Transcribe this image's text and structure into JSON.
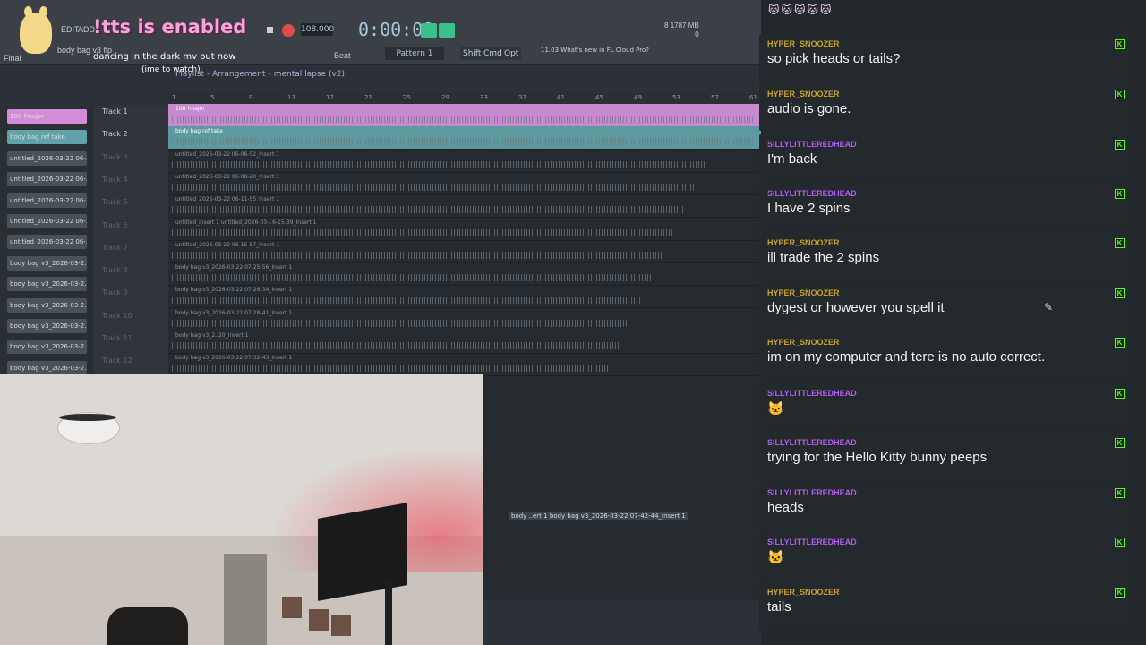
{
  "overlay": {
    "title": "!tts is enabled",
    "now_playing": "dancing in the dark mv out now",
    "now_playing_sub": "(ime to watch)"
  },
  "toolbar": {
    "edit_label": "EDIT",
    "add_label": "ADD",
    "project_name": "body bag v3 flp",
    "finalize_label": "Final",
    "bpm": "108.000",
    "time": "0:00:00",
    "cpu": "8",
    "memory": "1787 MB",
    "voices": "0",
    "beat_label": "Beat",
    "pattern_label": "Pattern 1",
    "shift_label": "Shift",
    "cmd_label": "Cmd",
    "opt_label": "Opt",
    "news_date": "11.03",
    "news_text": "What's new in FL Cloud Pro?"
  },
  "breadcrumb": {
    "section": "Playlist - Arrangement",
    "arrangement": "mental lapse (v2)"
  },
  "ruler": [
    "1",
    "5",
    "9",
    "13",
    "17",
    "21",
    "25",
    "29",
    "33",
    "37",
    "41",
    "45",
    "49",
    "53",
    "57",
    "61"
  ],
  "clips": [
    {
      "label": "108 fmajor",
      "color": "#d48bd8"
    },
    {
      "label": "body bag ref take",
      "color": "#5fa3a8"
    },
    {
      "label": "untitled_2026-03-22 06-...",
      "color": "#4a5258"
    },
    {
      "label": "untitled_2026-03-22 06-...",
      "color": "#4a5258"
    },
    {
      "label": "untitled_2026-03-22 06-...",
      "color": "#4a5258"
    },
    {
      "label": "untitled_2026-03-22 06-...",
      "color": "#4a5258"
    },
    {
      "label": "untitled_2026-03-22 06-...",
      "color": "#4a5258"
    },
    {
      "label": "body bag v3_2026-03-2...",
      "color": "#4a5258"
    },
    {
      "label": "body bag v3_2026-03-2...",
      "color": "#4a5258"
    },
    {
      "label": "body bag v3_2026-03-2...",
      "color": "#4a5258"
    },
    {
      "label": "body bag v3_2026-03-2...",
      "color": "#4a5258"
    },
    {
      "label": "body bag v3_2026-03-2...",
      "color": "#4a5258"
    },
    {
      "label": "body bag v3_2026-03-2...",
      "color": "#4a5258"
    }
  ],
  "tracks": [
    "Track 1",
    "Track 2",
    "Track 3",
    "Track 4",
    "Track 5",
    "Track 6",
    "Track 7",
    "Track 8",
    "Track 9",
    "Track 10",
    "Track 11",
    "Track 12"
  ],
  "lanes": [
    {
      "label": "108 fmajor"
    },
    {
      "label": "body bag ref take"
    },
    {
      "label": "untitled_2026-03-22 06-06-52_Insert 1"
    },
    {
      "label": "untitled_2026-03-22 06-08-20_Insert 1"
    },
    {
      "label": "untitled_2026-03-22 06-11-55_Insert 1"
    },
    {
      "label": "untitled_insert 1   untitled_2026-03-..6-15-39_Insert 1"
    },
    {
      "label": "untitled_2026-03-22 06-15-57_Insert 1"
    },
    {
      "label": "body bag v3_2026-03-22 07-25-56_Insert 1"
    },
    {
      "label": "body bag v3_2026-03-22 07-26-34_Insert 1"
    },
    {
      "label": "body bag v3_2026-03-22 07-28-41_Insert 1"
    },
    {
      "label": "body bag v3_2..20_Insert 1"
    },
    {
      "label": "body bag v3_2026-03-22 07-32-43_Insert 1"
    }
  ],
  "bottom_clip_label": "body ..ert 1   body bag v3_2026-03-22 07-42-44_Insert 1",
  "chat": {
    "top_emotes": "🐱🐱🐱🐱🐱",
    "messages": [
      {
        "user": "HYPER_SNOOZER",
        "text": "so pick heads or tails?",
        "color": "#c9a227"
      },
      {
        "user": "HYPER_SNOOZER",
        "text": "audio is gone.",
        "color": "#c9a227"
      },
      {
        "user": "SILLYLITTLEREDHEAD",
        "text": "I'm back",
        "color": "#b25cf0"
      },
      {
        "user": "SILLYLITTLEREDHEAD",
        "text": "I have 2 spins",
        "color": "#b25cf0"
      },
      {
        "user": "HYPER_SNOOZER",
        "text": "ill trade the 2 spins",
        "color": "#c9a227"
      },
      {
        "user": "HYPER_SNOOZER",
        "text": "dygest or however you spell it",
        "color": "#c9a227"
      },
      {
        "user": "HYPER_SNOOZER",
        "text": "im on my computer and tere is no auto correct.",
        "color": "#c9a227"
      },
      {
        "user": "SILLYLITTLEREDHEAD",
        "text": "🐱",
        "color": "#b25cf0"
      },
      {
        "user": "SILLYLITTLEREDHEAD",
        "text": "trying for the Hello Kitty bunny peeps",
        "color": "#b25cf0"
      },
      {
        "user": "SILLYLITTLEREDHEAD",
        "text": "heads",
        "color": "#b25cf0"
      },
      {
        "user": "SILLYLITTLEREDHEAD",
        "text": "🐱",
        "color": "#b25cf0"
      },
      {
        "user": "HYPER_SNOOZER",
        "text": "tails",
        "color": "#c9a227"
      }
    ],
    "badge_icon": "kick-badge-icon",
    "badge_glyph": "K"
  }
}
